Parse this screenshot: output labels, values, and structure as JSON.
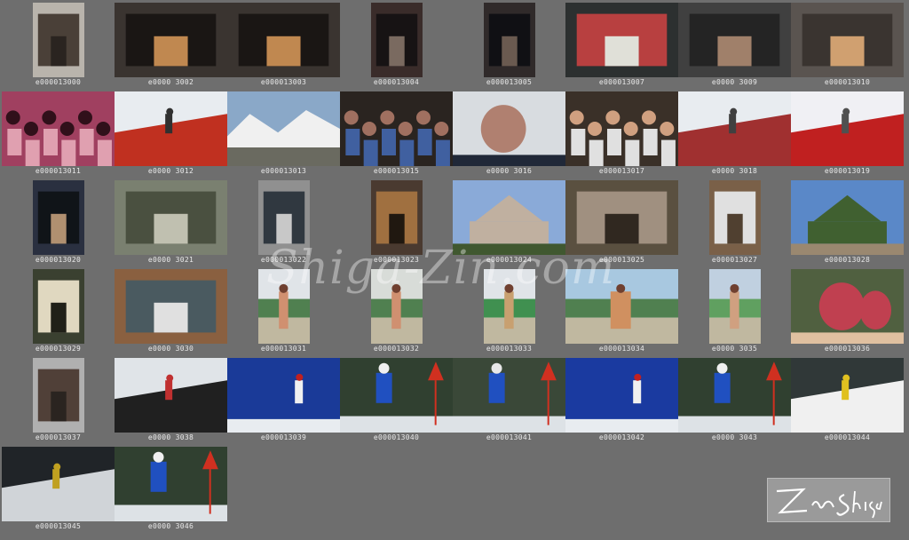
{
  "sheet": {
    "rows": [
      [
        {
          "caption": "e000013000",
          "subject": "street",
          "theme": [
            "#b9b4ac",
            "#4a4038",
            "#2a2420"
          ]
        },
        {
          "caption": "e0000 3002",
          "subject": "night-building",
          "theme": [
            "#3a3430",
            "#1a1614",
            "#c08850"
          ]
        },
        {
          "caption": "e000013003",
          "subject": "night-building",
          "theme": [
            "#3a3430",
            "#1a1614",
            "#c08850"
          ]
        },
        {
          "caption": "e000013004",
          "subject": "narrow-street",
          "theme": [
            "#3a2c2a",
            "#171314",
            "#7a6a60"
          ]
        },
        {
          "caption": "e000013005",
          "subject": "narrow-street",
          "theme": [
            "#302a2a",
            "#101014",
            "#6a5a50"
          ]
        },
        {
          "caption": "e000013007",
          "subject": "sign",
          "theme": [
            "#2c3030",
            "#b84040",
            "#e0e0d8"
          ]
        },
        {
          "caption": "e0000 3009",
          "subject": "night-building",
          "theme": [
            "#404040",
            "#242424",
            "#a0806a"
          ]
        },
        {
          "caption": "e000013010",
          "subject": "night-building",
          "theme": [
            "#5a5450",
            "#3a3430",
            "#d0a070"
          ]
        }
      ],
      [
        {
          "caption": "e000013011",
          "subject": "stage",
          "theme": [
            "#a04060",
            "#30101a",
            "#e0a0b0"
          ]
        },
        {
          "caption": "e0000 3012",
          "subject": "ski-snow",
          "theme": [
            "#e8ecf0",
            "#c03020",
            "#303030"
          ]
        },
        {
          "caption": "e000013013",
          "subject": "mountains",
          "theme": [
            "#8aa8c8",
            "#f0f0f0",
            "#6a6a60"
          ]
        },
        {
          "caption": "e000013015",
          "subject": "crowd",
          "theme": [
            "#2a2420",
            "#a07060",
            "#4060a0"
          ]
        },
        {
          "caption": "e0000 3016",
          "subject": "portrait",
          "theme": [
            "#d8dce0",
            "#b08070",
            "#202838"
          ]
        },
        {
          "caption": "e000013017",
          "subject": "crowd",
          "theme": [
            "#3a3028",
            "#d0a080",
            "#e0e0e0"
          ]
        },
        {
          "caption": "e0000 3018",
          "subject": "ski-snow",
          "theme": [
            "#e8ecf0",
            "#a03030",
            "#404040"
          ]
        },
        {
          "caption": "e000013019",
          "subject": "ski-snow",
          "theme": [
            "#f0f0f4",
            "#c02020",
            "#505050"
          ]
        }
      ],
      [
        {
          "caption": "e000013020",
          "subject": "interior",
          "theme": [
            "#2a3040",
            "#101418",
            "#b09070"
          ]
        },
        {
          "caption": "e0000 3021",
          "subject": "rocky-slope",
          "theme": [
            "#7a8070",
            "#4a5040",
            "#c0c0b0"
          ]
        },
        {
          "caption": "e000013022",
          "subject": "doorway",
          "theme": [
            "#909090",
            "#303840",
            "#c8c8c8"
          ]
        },
        {
          "caption": "e000013023",
          "subject": "barrel",
          "theme": [
            "#4a3a30",
            "#a07040",
            "#201810"
          ]
        },
        {
          "caption": "e000013024",
          "subject": "lodge",
          "theme": [
            "#8aaad8",
            "#405830",
            "#c0b0a0"
          ]
        },
        {
          "caption": "e000013025",
          "subject": "bottle",
          "theme": [
            "#5a5040",
            "#a09080",
            "#302820"
          ]
        },
        {
          "caption": "e000013027",
          "subject": "window",
          "theme": [
            "#7a6048",
            "#e0e0e0",
            "#504030"
          ]
        },
        {
          "caption": "e000013028",
          "subject": "lodge",
          "theme": [
            "#5a88c8",
            "#9a8870",
            "#406030"
          ]
        }
      ],
      [
        {
          "caption": "e000013029",
          "subject": "lamp",
          "theme": [
            "#3a4030",
            "#e0d8c0",
            "#202018"
          ]
        },
        {
          "caption": "e0000 3030",
          "subject": "floor",
          "theme": [
            "#8a6040",
            "#4a5a60",
            "#e0e0e0"
          ]
        },
        {
          "caption": "e000013031",
          "subject": "hula",
          "theme": [
            "#e0e4e8",
            "#508050",
            "#d09070"
          ]
        },
        {
          "caption": "e000013032",
          "subject": "hula",
          "theme": [
            "#d8dcd8",
            "#508050",
            "#d09070"
          ]
        },
        {
          "caption": "e000013033",
          "subject": "hula",
          "theme": [
            "#e0e4e8",
            "#409050",
            "#c8a070"
          ]
        },
        {
          "caption": "e000013034",
          "subject": "hula",
          "theme": [
            "#a8c8e0",
            "#508050",
            "#d09060"
          ]
        },
        {
          "caption": "e0000 3035",
          "subject": "hula",
          "theme": [
            "#c0d0e0",
            "#60a060",
            "#d0a080"
          ]
        },
        {
          "caption": "e000013036",
          "subject": "portrait-pair",
          "theme": [
            "#506040",
            "#c04050",
            "#e0c0a0"
          ]
        }
      ],
      [
        {
          "caption": "e000013037",
          "subject": "street",
          "theme": [
            "#b0b0b0",
            "#504038",
            "#2a2420"
          ]
        },
        {
          "caption": "e0000 3038",
          "subject": "ski-snow",
          "theme": [
            "#e0e4e8",
            "#202020",
            "#c03030"
          ]
        },
        {
          "caption": "e000013039",
          "subject": "ski-sky",
          "theme": [
            "#1a3a98",
            "#f0f0f0",
            "#c02020"
          ]
        },
        {
          "caption": "e000013040",
          "subject": "ski-race",
          "theme": [
            "#304030",
            "#f0f0f0",
            "#2050c0"
          ]
        },
        {
          "caption": "e000013041",
          "subject": "ski-race",
          "theme": [
            "#3a4838",
            "#e8e8e8",
            "#2050c0"
          ]
        },
        {
          "caption": "e000013042",
          "subject": "ski-sky",
          "theme": [
            "#1a3aa0",
            "#f0f0f0",
            "#c02020"
          ]
        },
        {
          "caption": "e0000 3043",
          "subject": "ski-race",
          "theme": [
            "#304030",
            "#f0f0f0",
            "#2050c0"
          ]
        },
        {
          "caption": "e000013044",
          "subject": "ski-snow",
          "theme": [
            "#303838",
            "#f0f0f0",
            "#e0c020"
          ]
        }
      ],
      [
        {
          "caption": "e000013045",
          "subject": "ski-night",
          "theme": [
            "#202428",
            "#d0d4d8",
            "#c0a020"
          ]
        },
        {
          "caption": "e0000 3046",
          "subject": "ski-race",
          "theme": [
            "#304030",
            "#f0f0f0",
            "#2050c0"
          ]
        }
      ]
    ],
    "watermark": "Shiga-Zin.com",
    "signature": "Zin Shiga"
  }
}
